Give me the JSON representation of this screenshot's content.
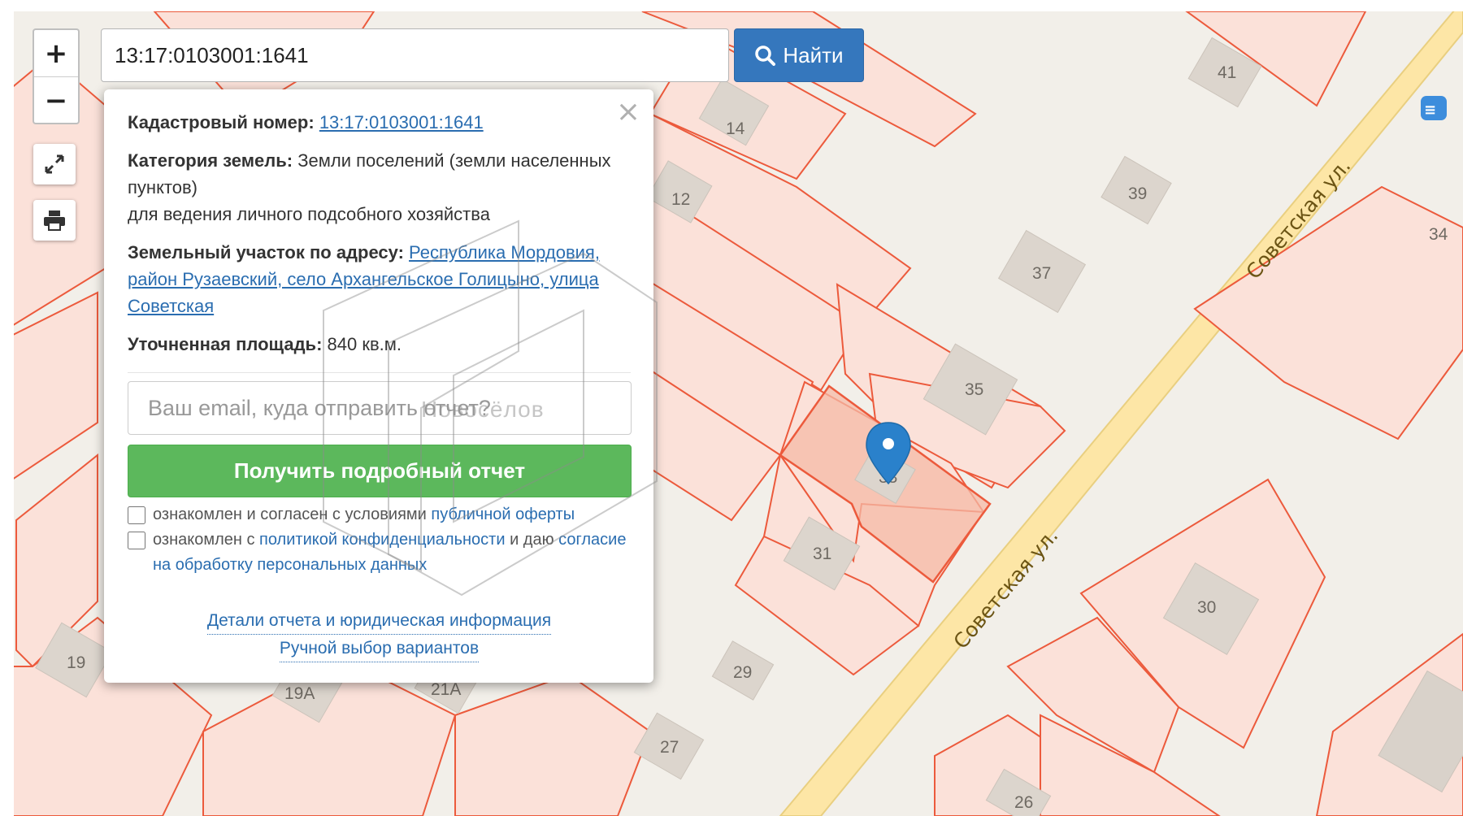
{
  "search": {
    "value": "13:17:0103001:1641",
    "button_label": "Найти"
  },
  "controls": {
    "zoom_in": "+",
    "zoom_out": "−"
  },
  "popup": {
    "cadastral_label": "Кадастровый номер:",
    "cadastral_value": "13:17:0103001:1641",
    "category_label": "Категория земель:",
    "category_value": "Земли поселений (земли населенных пунктов)",
    "usage": "для ведения личного подсобного хозяйства",
    "address_label": "Земельный участок по адресу:",
    "address_value": "Республика Мордовия, район Рузаевский, село Архангельское Голицыно, улица Советская",
    "area_label": "Уточненная площадь:",
    "area_value": "840 кв.м.",
    "email_placeholder": "Ваш email, куда отправить отчет?",
    "report_button": "Получить подробный отчет",
    "agree1_text": "ознакомлен и согласен с условиями",
    "agree1_link": "публичной оферты",
    "agree2_text": "ознакомлен с",
    "agree2_link": "политикой конфиденциальности",
    "agree2_mid": "и даю",
    "agree2_link2": "согласие на обработку персональных данных",
    "link_details": "Детали отчета и юридическая информация",
    "link_manual": "Ручной выбор вариантов"
  },
  "watermark": "Новосёлов",
  "map": {
    "house_numbers": [
      "41",
      "14",
      "12",
      "39",
      "37",
      "34",
      "35",
      "33",
      "31",
      "30",
      "29",
      "27",
      "26",
      "19",
      "19А",
      "21А"
    ],
    "streets": [
      "Советская ул.",
      "Советская ул."
    ],
    "colors": {
      "parcel_fill": "#fbe1d9",
      "parcel_stroke": "#ec5a3c",
      "road": "#fde6a6",
      "marker": "#2a81cb"
    }
  }
}
